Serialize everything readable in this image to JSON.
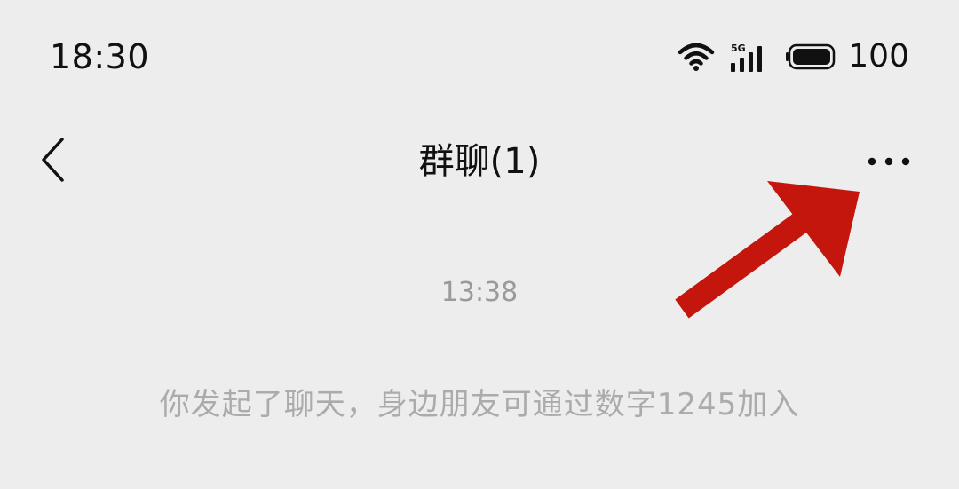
{
  "status_bar": {
    "time": "18:30",
    "network_label": "5G",
    "battery_level": "100",
    "icons": [
      "wifi-icon",
      "signal-icon",
      "battery-icon"
    ]
  },
  "nav": {
    "back_icon": "chevron-left-icon",
    "title": "群聊(1)",
    "more_icon": "more-dots-icon"
  },
  "chat": {
    "timestamp": "13:38",
    "system_message": "你发起了聊天，身边朋友可通过数字1245加入"
  },
  "annotation": {
    "arrow_color": "#c4160c"
  },
  "colors": {
    "background": "#ededed",
    "text_primary": "#111111",
    "text_secondary": "#9a9a9a"
  }
}
